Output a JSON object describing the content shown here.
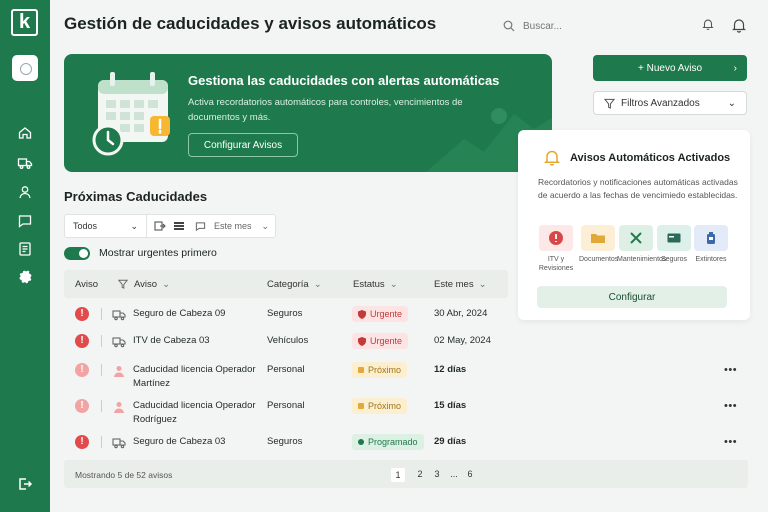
{
  "app": {
    "logo_letter": "k",
    "page_title": "Gestión de caducidades y avisos automáticos"
  },
  "search": {
    "placeholder": "Buscar..."
  },
  "hero": {
    "title": "Gestiona las caducidades con alertas automáticas",
    "description": "Activa recordatorios automáticos para controles, vencimientos de documentos y más.",
    "button": "Configurar Avisos"
  },
  "actions": {
    "new_alert": "+ Nuevo Aviso",
    "advanced_filters": "Filtros Avanzados"
  },
  "auto_card": {
    "title": "Avisos Automáticos Activados",
    "description": "Recordatorios y notificaciones automáticas activadas de acuerdo a las fechas de vencimiedo establecidas.",
    "categories": [
      {
        "label": "ITV y Revisiones",
        "icon": "alert-circle-icon",
        "bg": "#fde8e8",
        "color": "#d94848"
      },
      {
        "label": "Documentos",
        "icon": "folder-icon",
        "bg": "#fcefd6",
        "color": "#e2a93a"
      },
      {
        "label": "Mantenimientos",
        "icon": "tools-icon",
        "bg": "#def0e5",
        "color": "#1e7a4c"
      },
      {
        "label": "Seguros",
        "icon": "card-icon",
        "bg": "#def0ea",
        "color": "#2b6a5a"
      },
      {
        "label": "Extintores",
        "icon": "extinguisher-icon",
        "bg": "#e2ebf7",
        "color": "#3b6aa8"
      }
    ],
    "button": "Configurar"
  },
  "section": {
    "title": "Próximas Caducidades",
    "filter_select": "Todos",
    "month_filter": "Este mes",
    "toggle_label": "Mostrar urgentes primero",
    "toggle_on": true
  },
  "table": {
    "headers": {
      "aviso": "Aviso",
      "aviso2": "Aviso",
      "categoria": "Categoría",
      "estatus": "Estatus",
      "fecha": "Este mes"
    },
    "rows": [
      {
        "name": "Seguro de Cabeza 09",
        "name2": "",
        "category": "Seguros",
        "status": "Urgente",
        "status_type": "urgent",
        "date": "30 Abr, 2024",
        "date_bold": false,
        "icon": "truck-icon",
        "alert_color": "#e24b4b",
        "more": ""
      },
      {
        "name": "ITV de Cabeza 03",
        "name2": "",
        "category": "Vehículos",
        "status": "Urgente",
        "status_type": "urgent",
        "date": "02 May, 2024",
        "date_bold": false,
        "icon": "truck-icon",
        "alert_color": "#e24b4b",
        "more": ""
      },
      {
        "name": "Caducidad licencia Operador",
        "name2": "Martínez",
        "category": "Personal",
        "status": "Próximo",
        "status_type": "next",
        "date": "12 días",
        "date_bold": true,
        "icon": "user-icon",
        "alert_color": "#f0a4a4",
        "more": "•••"
      },
      {
        "name": "Caducidad licencia Operador",
        "name2": "Rodríguez",
        "category": "Personal",
        "status": "Próximo",
        "status_type": "next",
        "date": "15 días",
        "date_bold": true,
        "icon": "user-icon",
        "alert_color": "#f0a4a4",
        "more": "•••"
      },
      {
        "name": "Seguro de Cabeza 03",
        "name2": "",
        "category": "Seguros",
        "status": "Programado",
        "status_type": "scheduled",
        "date": "29 días",
        "date_bold": true,
        "icon": "truck-icon",
        "alert_color": "#e24b4b",
        "more": "•••"
      }
    ]
  },
  "footer": {
    "summary": "Mostrando 5 de 52 avisos",
    "pages": [
      "1",
      "2",
      "3",
      "...",
      "6"
    ],
    "active_page": "1"
  },
  "colors": {
    "brand": "#1e7a4c",
    "urgent_bg": "#fde4e4",
    "urgent_fg": "#c23a3a",
    "next_bg": "#fbefcf",
    "next_fg": "#a07415",
    "scheduled_bg": "#dcf0e3",
    "scheduled_fg": "#1e7a4c"
  }
}
